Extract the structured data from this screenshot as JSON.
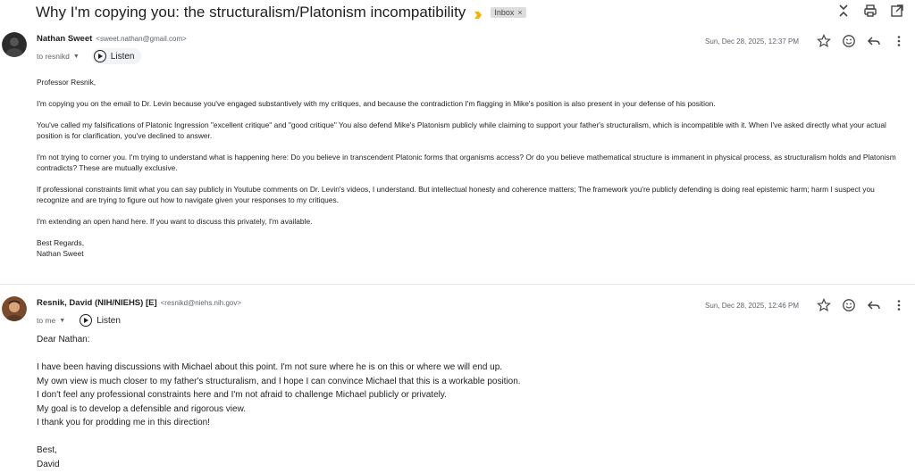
{
  "thread": {
    "subject": "Why I'm copying you: the structuralism/Platonism incompatibility",
    "label": "Inbox",
    "label_remove": "×"
  },
  "toolbar": {
    "icons": [
      "collapse-all-icon",
      "print-icon",
      "open-in-new-window-icon"
    ]
  },
  "messages": [
    {
      "sender_name": "Nathan Sweet",
      "sender_email": "<sweet.nathan@gmail.com>",
      "to": "to resnikd",
      "listen_label": "Listen",
      "date": "Sun, Dec 28, 2025, 12:37 PM",
      "paragraphs": [
        "Professor Resnik,",
        "I'm copying you on the email to Dr. Levin because you've engaged substantively with my critiques, and because the contradiction I'm flagging in Mike's position is also present in your defense of his position.",
        "You've called my falsifications of Platonic Ingression \"excellent critique\" and \"good critique\" You also defend Mike's Platonism publicly while claiming to support your father's structuralism, which is incompatible with it. When I've asked directly what your actual position is for clarification, you've declined to answer.",
        "I'm not trying to corner you. I'm trying to understand what is happening here: Do you believe in transcendent Platonic forms that organisms access? Or do you believe mathematical structure is immanent in physical process, as structuralism holds and Platonism contradicts? These are mutually exclusive.",
        "If professional constraints limit what you can say publicly in Youtube comments on Dr. Levin's videos, I understand. But intellectual honesty and coherence matters; The framework you're publicly defending is doing real epistemic harm; harm I suspect you recognize and are trying to figure out how to navigate given your responses to my critiques.",
        "I'm extending an open hand here. If you want to discuss this privately, I'm available."
      ],
      "signoff": "Best Regards,",
      "signature": "Nathan Sweet"
    },
    {
      "sender_name": "Resnik, David (NIH/NIEHS) [E]",
      "sender_email": "<resnikd@niehs.nih.gov>",
      "to": "to me",
      "listen_label": "Listen",
      "date": "Sun, Dec 28, 2025, 12:46 PM",
      "greeting": "Dear Nathan:",
      "lines": [
        "I have been having discussions with Michael about this point.  I'm not sure where he is on this or where we will end up.",
        "My own view is much closer to my father's structuralism, and I hope I can convince Michael that this is a workable position.",
        "I don't feel any professional constraints here and I'm not afraid to challenge Michael publicly or privately.",
        "My goal is to develop a defensible and rigorous view.",
        "I thank you for prodding me in this direction!"
      ],
      "signoff": "Best,",
      "signature": "David"
    }
  ],
  "colors": {
    "importance_marker": "#f4b400",
    "label_bg": "#dddddd",
    "muted_text": "#5f6368"
  }
}
